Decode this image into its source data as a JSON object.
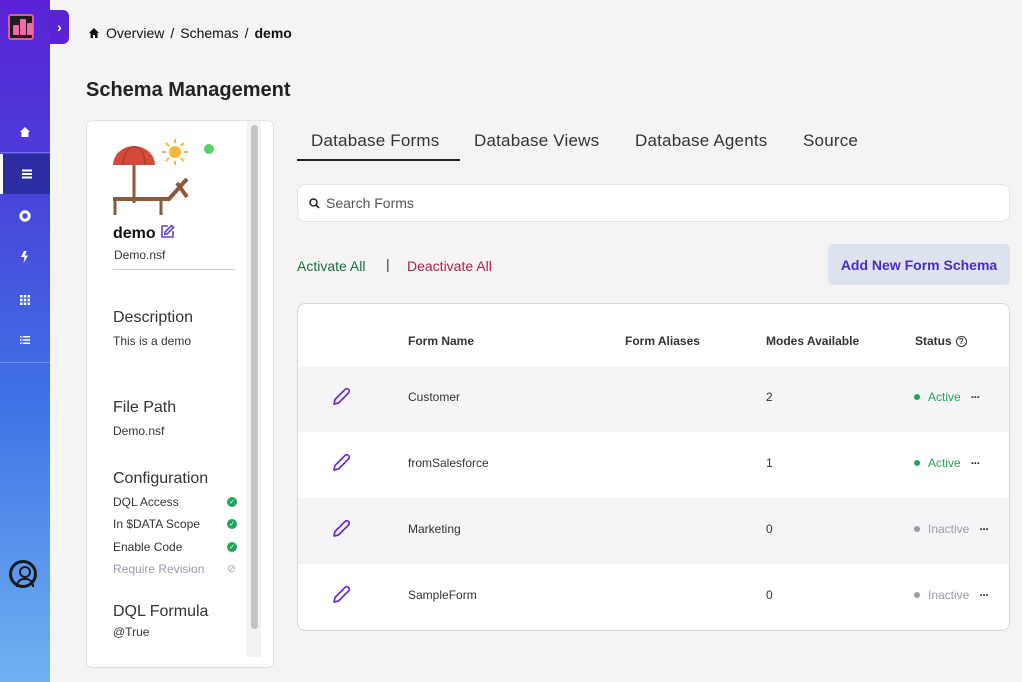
{
  "breadcrumb": {
    "items": [
      "Overview",
      "Schemas"
    ],
    "current": "demo",
    "separator": "/"
  },
  "page_title": "Schema Management",
  "schema": {
    "name": "demo",
    "file": "Demo.nsf",
    "description_label": "Description",
    "description": "This is a demo",
    "file_path_label": "File Path",
    "file_path": "Demo.nsf",
    "configuration_label": "Configuration",
    "configuration": [
      {
        "label": "DQL Access",
        "enabled": true
      },
      {
        "label": "In $DATA Scope",
        "enabled": true
      },
      {
        "label": "Enable Code",
        "enabled": true
      },
      {
        "label": "Require Revision",
        "enabled": false
      }
    ],
    "dql_formula_label": "DQL Formula",
    "dql_formula": "@True"
  },
  "tabs": [
    "Database Forms",
    "Database Views",
    "Database Agents",
    "Source"
  ],
  "active_tab": "Database Forms",
  "search": {
    "placeholder": "Search Forms"
  },
  "actions": {
    "activate_all": "Activate All",
    "deactivate_all": "Deactivate All",
    "add_new": "Add New Form Schema"
  },
  "table": {
    "headers": {
      "form_name": "Form Name",
      "form_aliases": "Form Aliases",
      "modes_available": "Modes Available",
      "status": "Status"
    },
    "rows": [
      {
        "form_name": "Customer",
        "form_aliases": "",
        "modes": "2",
        "status": "Active"
      },
      {
        "form_name": "fromSalesforce",
        "form_aliases": "",
        "modes": "1",
        "status": "Active"
      },
      {
        "form_name": "Marketing",
        "form_aliases": "",
        "modes": "0",
        "status": "Inactive"
      },
      {
        "form_name": "SampleForm",
        "form_aliases": "",
        "modes": "0",
        "status": "Inactive"
      }
    ]
  },
  "colors": {
    "accent": "#5a22d6",
    "active": "#22a35a",
    "inactive": "#9a9aa8",
    "danger": "#b01e52",
    "success_text": "#1d6e3d"
  },
  "icons": {
    "rail": [
      "home-icon",
      "list-icon",
      "circle-icon",
      "bolt-icon",
      "grid-icon",
      "list-bullets-icon"
    ],
    "user": "user-circle-icon"
  }
}
